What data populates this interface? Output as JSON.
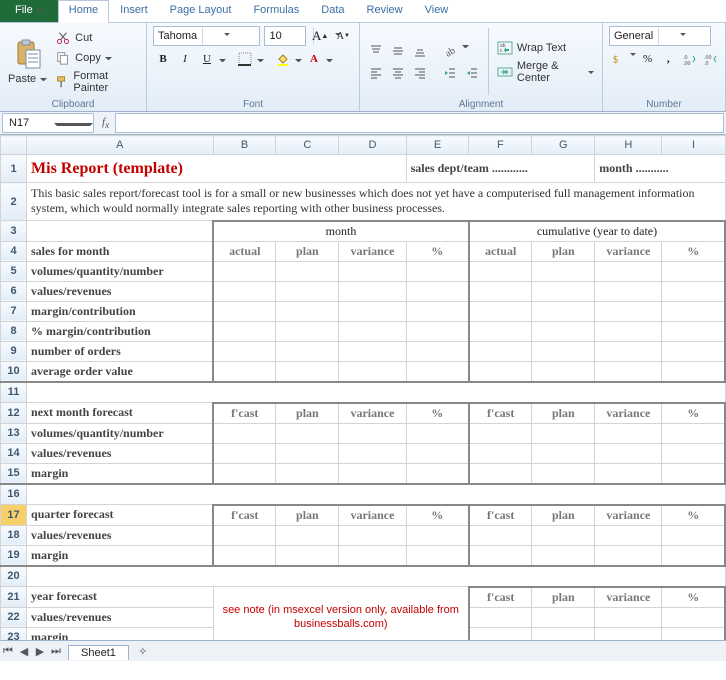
{
  "tabs": {
    "file": "File",
    "home": "Home",
    "insert": "Insert",
    "pagelayout": "Page Layout",
    "formulas": "Formulas",
    "data": "Data",
    "review": "Review",
    "view": "View"
  },
  "clip": {
    "paste": "Paste",
    "cut": "Cut",
    "copy": "Copy",
    "painter": "Format Painter",
    "title": "Clipboard"
  },
  "font": {
    "name": "Tahoma",
    "size": "10",
    "title": "Font"
  },
  "align": {
    "wrap": "Wrap Text",
    "merge": "Merge & Center",
    "title": "Alignment"
  },
  "num": {
    "format": "General",
    "title": "Number"
  },
  "namebox": "N17",
  "cols": [
    "A",
    "B",
    "C",
    "D",
    "E",
    "F",
    "G",
    "H",
    "I"
  ],
  "rows": [
    "1",
    "2",
    "3",
    "4",
    "5",
    "6",
    "7",
    "8",
    "9",
    "10",
    "11",
    "12",
    "13",
    "14",
    "15",
    "16",
    "17",
    "18",
    "19",
    "20",
    "21",
    "22",
    "23"
  ],
  "r1": {
    "title": "Mis Report (template)",
    "team": "sales dept/team ............",
    "month": "month  ..........."
  },
  "r2": "This basic sales report/forecast tool is for a small or new businesses which does not yet have a computerised full management information system, which would normally integrate sales reporting with other business processes.",
  "r3": {
    "month": "month",
    "cum": "cumulative (year to date)"
  },
  "hdrA": [
    "actual",
    "plan",
    "variance",
    "%",
    "actual",
    "plan",
    "variance",
    "%"
  ],
  "hdrF": [
    "f'cast",
    "plan",
    "variance",
    "%",
    "f'cast",
    "plan",
    "variance",
    "%"
  ],
  "labels": {
    "salesMonth": "sales for month",
    "vol": "volumes/quantity/number",
    "val": "values/revenues",
    "marg": "margin/contribution",
    "pmarg": "% margin/contribution",
    "ord": "number of orders",
    "avg": "average order value",
    "nextF": "next month forecast",
    "margS": "margin",
    "qF": "quarter forecast",
    "yF": "year forecast"
  },
  "note": "see note (in msexcel version only, available from businessballs.com)",
  "sheettab": "Sheet1"
}
